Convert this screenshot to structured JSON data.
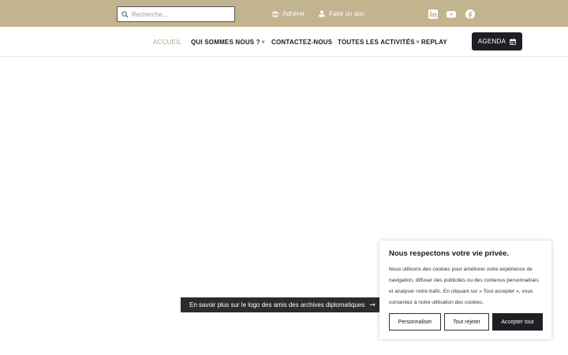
{
  "colors": {
    "topbar": "#c2b48f",
    "accent": "#b9a77a",
    "dark": "#1e1e24",
    "banner": "#2c2c2e"
  },
  "search": {
    "placeholder": "Recherche..."
  },
  "topbar": {
    "adherer_label": "Adhérer",
    "adherer_icon": "users-icon",
    "don_label": "Faire un don",
    "don_icon": "donate-icon",
    "socials": [
      "linkedin-icon",
      "youtube-icon",
      "facebook-icon"
    ]
  },
  "nav": {
    "items": [
      {
        "label": "ACCUEIL",
        "active": true
      },
      {
        "label": "QUI SOMMES NOUS ?",
        "dropdown": true
      },
      {
        "label": "CONTACTEZ-NOUS"
      },
      {
        "label": "TOUTES LES ACTIVITÉS",
        "dropdown": true
      },
      {
        "label": "REPLAY"
      }
    ],
    "chevron": "˅"
  },
  "agenda": {
    "label": "AGENDA",
    "icon": "calendar-icon"
  },
  "banner": {
    "label": "En savoir plus sur le logo des amis des archives diplomatiques",
    "arrow": "➞"
  },
  "cookie": {
    "title": "Nous respectons votre vie privée.",
    "text": "Nous utilisons des cookies pour améliorer votre expérience de navigation, diffuser des publicités ou des contenus personnalisés et analyser notre trafic. En cliquant sur « Tout accepter », vous consentez à notre utilisation des cookies.",
    "customize_label": "Personnaliser",
    "reject_label": "Tout rejeter",
    "accept_label": "Accepter tout"
  }
}
